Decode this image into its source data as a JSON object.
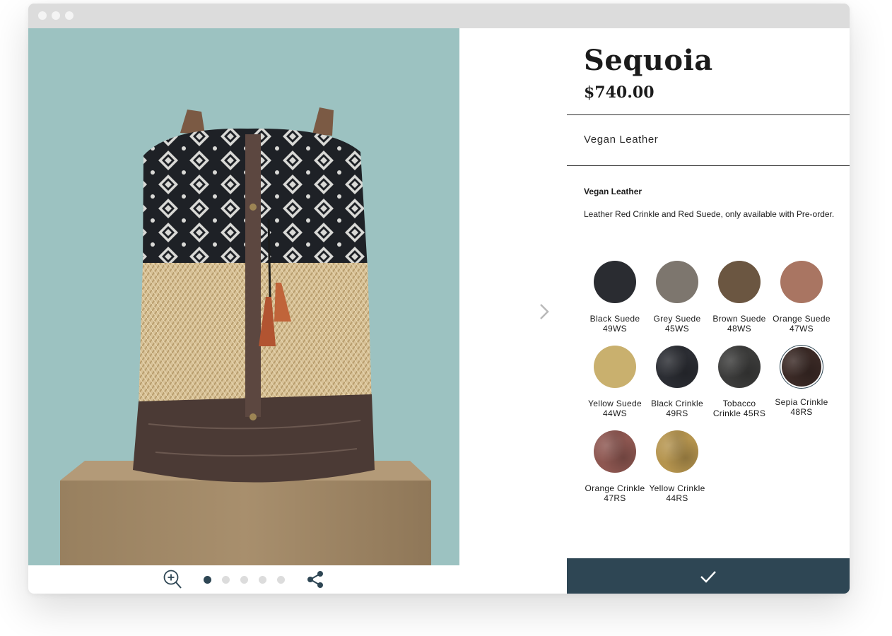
{
  "product": {
    "title": "Sequoia",
    "price": "$740.00",
    "material_selected": "Vegan Leather",
    "description_heading": "Vegan Leather",
    "description": "Leather Red Crinkle and Red Suede, only available with Pre-order."
  },
  "gallery": {
    "image_count": 5,
    "active_index": 0,
    "zoom_icon": "zoom-in-icon",
    "share_icon": "share-icon",
    "next_icon": "chevron-right-icon"
  },
  "swatches": [
    {
      "label": "Black Suede 49WS",
      "color": "#2a2c31"
    },
    {
      "label": "Grey Suede 45WS",
      "color": "#7d766e"
    },
    {
      "label": "Brown Suede 48WS",
      "color": "#6b5641"
    },
    {
      "label": "Orange Suede 47WS",
      "color": "#a97562"
    },
    {
      "label": "Yellow Suede 44WS",
      "color": "#c9b06e"
    },
    {
      "label": "Black Crinkle 49RS",
      "color": "#2b2d33"
    },
    {
      "label": "Tobacco Crinkle 45RS",
      "color": "#3c3c3b"
    },
    {
      "label": "Sepia Crinkle 48RS",
      "color": "#3b2a26",
      "selected": true
    },
    {
      "label": "Orange Crinkle 47RS",
      "color": "#8e5751"
    },
    {
      "label": "Yellow Crinkle 44RS",
      "color": "#b5944e"
    }
  ],
  "confirm_icon": "checkmark-icon",
  "colors": {
    "accent": "#2e4654",
    "photo_background": "#9cc2c1"
  }
}
